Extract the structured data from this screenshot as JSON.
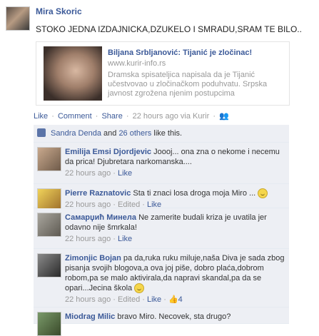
{
  "post": {
    "author": "Mira Skoric",
    "text": "STOKO JEDNA IZDAJNICKA,DZUKELO I SMRADU,SRAM TE BILO..",
    "link_card": {
      "title": "Biljana Srbljanović: Tijanić je zločinac!",
      "domain": "www.kurir-info.rs",
      "description": "Dramska spisateljica napisala da je Tijanić učestvovao u zločinačkom poduhvatu. Srpska javnost zgrožena njenim postupcima"
    },
    "actions": {
      "like": "Like",
      "comment": "Comment",
      "share": "Share",
      "time": "22 hours ago via Kurir"
    },
    "likes": {
      "name": "Sandra Denda",
      "others": "26 others",
      "suffix": "like this.",
      "and": "and"
    }
  },
  "comments": [
    {
      "name": "Emilija Emsi Djordjevic",
      "text": "Joooj... ona zna o nekome i necemu da prica! Djubretara narkomanska....",
      "time": "22 hours ago",
      "like": "Like"
    },
    {
      "name": "Pierre Raznatovic",
      "text": "Sta ti znaci losa droga moja Miro ...",
      "time": "22 hours ago",
      "edited": "Edited",
      "like": "Like"
    },
    {
      "name": "Самарџић Минела",
      "text": "Ne zamerite budali kriza je uvatila jer odavno nije šmrkala!",
      "time": "22 hours ago",
      "like": "Like"
    },
    {
      "name": "Zimonjic Bojan",
      "text": "pa da,ruka ruku miluje,naša Diva je sada zbog pisanja svojih blogova,a ova joj piše, dobro plaća,dobrom robom,pa se malo aktivirala,da napravi skandal,pa da se opari...Jecina škola",
      "time": "22 hours ago",
      "edited": "Edited",
      "like": "Like",
      "like_count": "4"
    },
    {
      "name": "Miodrag Milic",
      "text": "bravo Miro. Necovek, sta drugo?"
    }
  ]
}
